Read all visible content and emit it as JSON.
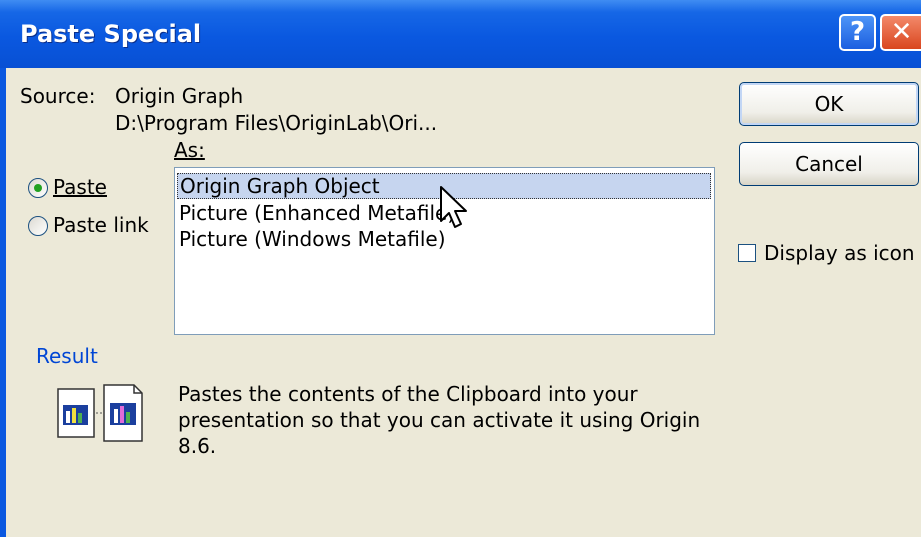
{
  "window": {
    "title": "Paste Special",
    "help_glyph": "?",
    "close_glyph": "✕"
  },
  "source": {
    "label": "Source:",
    "name": "Origin Graph",
    "path": "D:\\Program Files\\OriginLab\\Ori..."
  },
  "as_label": "As:",
  "options": {
    "paste": {
      "label": "Paste",
      "selected": true
    },
    "paste_link": {
      "label": "Paste link",
      "selected": false
    }
  },
  "list": {
    "items": [
      "Origin Graph Object",
      "Picture (Enhanced Metafile)",
      "Picture (Windows Metafile)"
    ],
    "selected_index": 0
  },
  "buttons": {
    "ok": "OK",
    "cancel": "Cancel"
  },
  "display_as_icon": {
    "label": "Display as icon",
    "checked": false
  },
  "result": {
    "label": "Result",
    "text": "Pastes the contents of the Clipboard into your presentation so that you can activate it using Origin 8.6."
  },
  "colors": {
    "titlebar": "#0a58e0",
    "dialog": "#ece9d8",
    "selection": "#c6d5ef",
    "result_label": "#0046d5",
    "radio_dot": "#21a121"
  },
  "icons": [
    "help-icon",
    "close-icon",
    "paste-result-icon",
    "mouse-cursor-icon"
  ]
}
